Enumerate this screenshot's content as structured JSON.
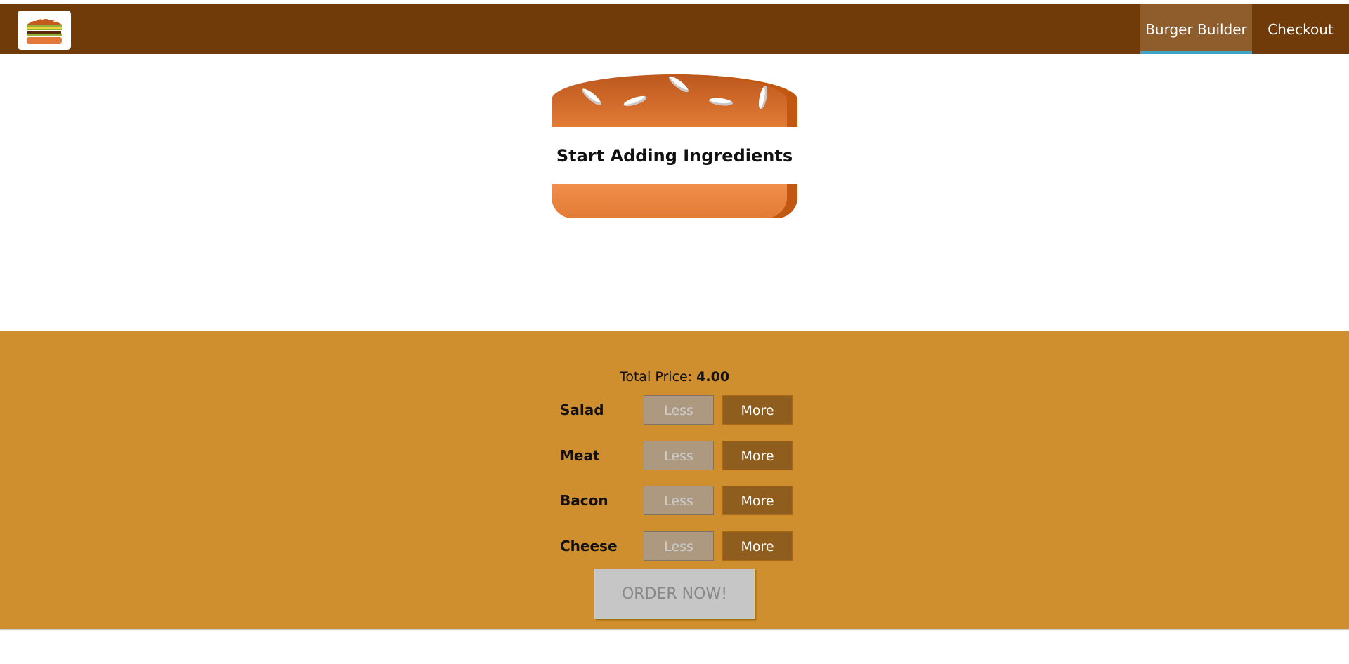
{
  "nav": {
    "items": [
      {
        "label": "Burger Builder",
        "active": true
      },
      {
        "label": "Checkout",
        "active": false
      }
    ]
  },
  "burger": {
    "message": "Start Adding Ingredients"
  },
  "controls": {
    "price_label": "Total Price:",
    "price_value": "4.00",
    "rows": [
      {
        "label": "Salad",
        "less": "Less",
        "more": "More"
      },
      {
        "label": "Meat",
        "less": "Less",
        "more": "More"
      },
      {
        "label": "Bacon",
        "less": "Less",
        "more": "More"
      },
      {
        "label": "Cheese",
        "less": "Less",
        "more": "More"
      }
    ],
    "order_label": "ORDER NOW!"
  },
  "colors": {
    "toolbar": "#703b09",
    "active_tab": "#8f5c2c",
    "active_underline": "#40a4c8",
    "controls_bg": "#cf8f2e",
    "more_button": "#8f5e1e",
    "less_button_disabled": "#ac9980",
    "order_button_disabled": "#c7c6c6"
  }
}
